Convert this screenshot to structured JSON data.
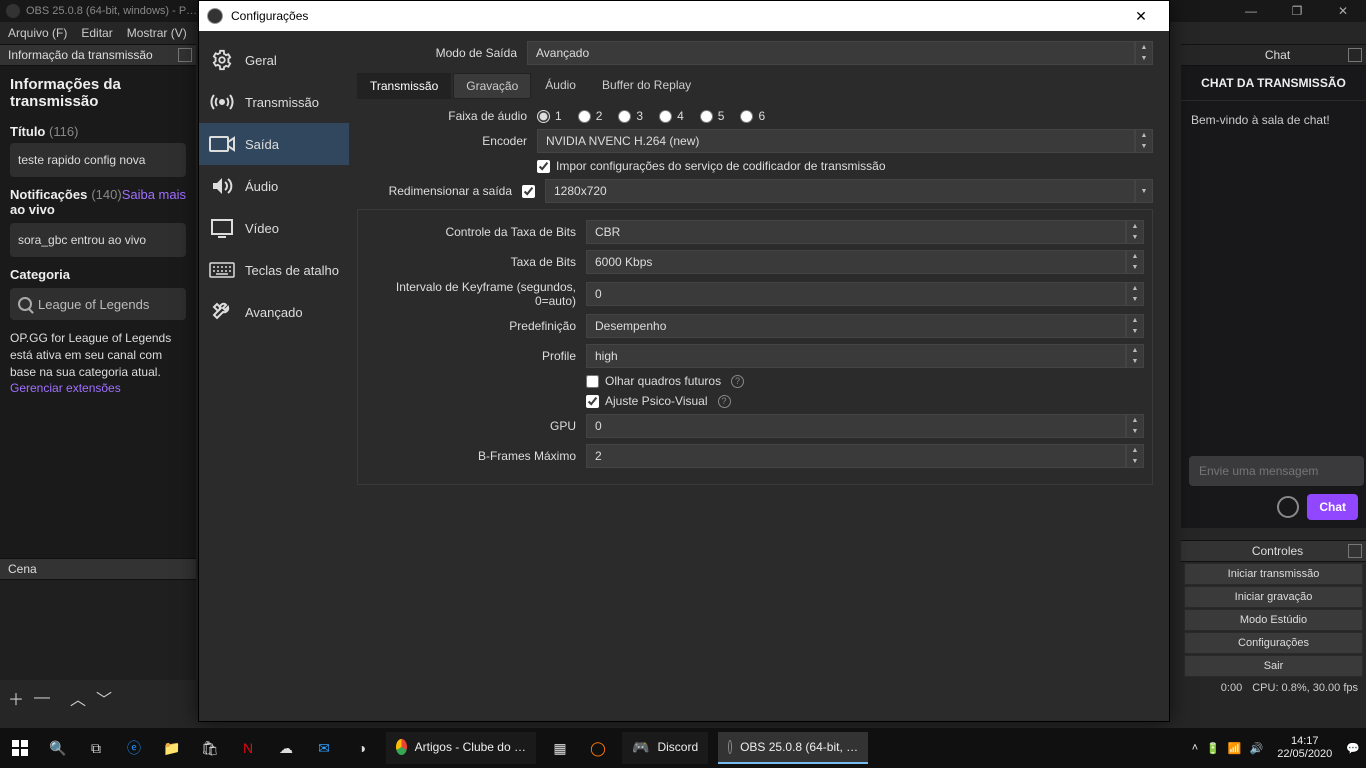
{
  "main_window": {
    "title": "OBS 25.0.8 (64-bit, windows) - P…",
    "win_minimize": "—",
    "win_maximize": "❐",
    "win_close": "✕",
    "menu": {
      "file": "Arquivo (F)",
      "edit": "Editar",
      "show": "Mostrar (V)"
    }
  },
  "info_dock": {
    "header": "Informação da transmissão",
    "heading": "Informações da transmissão",
    "title_label": "Título",
    "title_count": "(116)",
    "title_value": "teste rapido config nova",
    "notif_label": "Notificações\nao vivo",
    "notif_count": "(140)",
    "notif_link": "Saiba mais",
    "notif_value": "sora_gbc entrou ao vivo",
    "category_label": "Categoria",
    "category_value": "League of Legends",
    "ext_text": "OP.GG for League of Legends está ativa em seu canal com base na sua categoria atual. ",
    "ext_link": "Gerenciar extensões"
  },
  "scenes_dock": {
    "header": "Cena",
    "add": "＋",
    "remove": "—",
    "up": "︿",
    "down": "﹀"
  },
  "chat_dock": {
    "header": "Chat",
    "title": "CHAT DA TRANSMISSÃO",
    "welcome": "Bem-vindo à sala de chat!",
    "placeholder": "Envie uma mensagem",
    "send": "Chat"
  },
  "controls_dock": {
    "header": "Controles",
    "start_stream": "Iniciar transmissão",
    "start_rec": "Iniciar gravação",
    "studio": "Modo Estúdio",
    "settings": "Configurações",
    "exit": "Sair",
    "status_time": "0:00",
    "status_cpu": "CPU: 0.8%, 30.00 fps"
  },
  "settings": {
    "title": "Configurações",
    "close": "✕",
    "nav": {
      "general": "Geral",
      "stream": "Transmissão",
      "output": "Saída",
      "audio": "Áudio",
      "video": "Vídeo",
      "hotkeys": "Teclas de atalho",
      "advanced": "Avançado"
    },
    "output_mode_label": "Modo de Saída",
    "output_mode_value": "Avançado",
    "tabs": {
      "streaming": "Transmissão",
      "recording": "Gravação",
      "audio": "Áudio",
      "replay": "Buffer do Replay"
    },
    "audio_track_label": "Faixa de áudio",
    "tracks": [
      "1",
      "2",
      "3",
      "4",
      "5",
      "6"
    ],
    "encoder_label": "Encoder",
    "encoder_value": "NVIDIA NVENC H.264 (new)",
    "enforce_label": "Impor configurações do serviço de codificador de transmissão",
    "rescale_label": "Redimensionar a saída",
    "rescale_value": "1280x720",
    "rate_control_label": "Controle da Taxa de Bits",
    "rate_control_value": "CBR",
    "bitrate_label": "Taxa de Bits",
    "bitrate_value": "6000 Kbps",
    "keyframe_label": "Intervalo de Keyframe (segundos, 0=auto)",
    "keyframe_value": "0",
    "preset_label": "Predefinição",
    "preset_value": "Desempenho",
    "profile_label": "Profile",
    "profile_value": "high",
    "lookahead_label": "Olhar quadros futuros",
    "psycho_label": "Ajuste Psico-Visual",
    "gpu_label": "GPU",
    "gpu_value": "0",
    "bframes_label": "B-Frames Máximo",
    "bframes_value": "2"
  },
  "taskbar": {
    "apps": {
      "chrome": "Artigos - Clube do …",
      "discord": "Discord",
      "obs": "OBS 25.0.8 (64-bit, …"
    },
    "time": "14:17",
    "date": "22/05/2020"
  }
}
